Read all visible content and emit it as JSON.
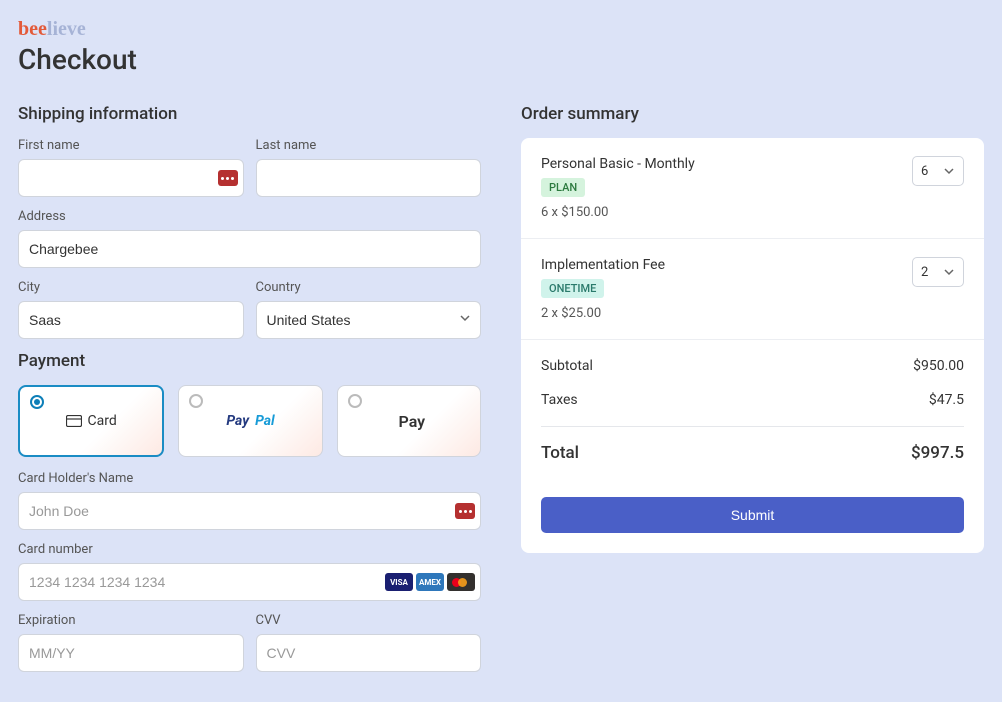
{
  "brand": {
    "part1": "bee",
    "part2": "lieve"
  },
  "page_title": "Checkout",
  "shipping": {
    "heading": "Shipping information",
    "first_name_label": "First name",
    "first_name_value": "",
    "last_name_label": "Last name",
    "last_name_value": "",
    "address_label": "Address",
    "address_value": "Chargebee",
    "city_label": "City",
    "city_value": "Saas",
    "country_label": "Country",
    "country_value": "United States"
  },
  "payment": {
    "heading": "Payment",
    "options": {
      "card": "Card",
      "paypal_p1": "Pay",
      "paypal_p2": "Pal",
      "applepay": "Pay"
    },
    "holder_label": "Card Holder's Name",
    "holder_placeholder": "John Doe",
    "number_label": "Card number",
    "number_placeholder": "1234 1234 1234 1234",
    "exp_label": "Expiration",
    "exp_placeholder": "MM/YY",
    "cvv_label": "CVV",
    "cvv_placeholder": "CVV",
    "brands": {
      "visa": "VISA",
      "amex": "AMEX"
    }
  },
  "order": {
    "heading": "Order summary",
    "items": [
      {
        "name": "Personal Basic - Monthly",
        "badge": "PLAN",
        "qty": "6",
        "breakdown": "6 x $150.00"
      },
      {
        "name": "Implementation Fee",
        "badge": "ONETIME",
        "qty": "2",
        "breakdown": "2 x $25.00"
      }
    ],
    "subtotal_label": "Subtotal",
    "subtotal_value": "$950.00",
    "taxes_label": "Taxes",
    "taxes_value": "$47.5",
    "total_label": "Total",
    "total_value": "$997.5",
    "submit": "Submit"
  }
}
